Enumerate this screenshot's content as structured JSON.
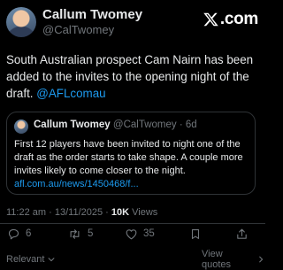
{
  "author": {
    "name": "Callum Twomey",
    "handle": "@CalTwomey"
  },
  "brand": {
    "label": ".com",
    "icon": "x-logo-icon"
  },
  "tweet": {
    "text": "South Australian prospect Cam Nairn has been added to the invites to the opening night of the draft.",
    "mention": "@AFLcomau"
  },
  "quote": {
    "name": "Callum Twomey",
    "handle": "@CalTwomey",
    "age": "6d",
    "text": "First 12 players have been invited to night one of the draft as the order starts to take shape. A couple more invites likely to come closer to the night.",
    "link": "afl.com.au/news/1450468/f..."
  },
  "meta": {
    "time": "11:22 am",
    "date": "13/11/2025",
    "views_count": "10K",
    "views_label": "Views"
  },
  "actions": {
    "replies": "6",
    "reposts": "5",
    "likes": "35"
  },
  "footer": {
    "sort_label": "Relevant",
    "view_quotes_label": "View quotes"
  },
  "colors": {
    "background": "#000000",
    "text": "#e7e9ea",
    "muted": "#71767b",
    "link": "#1d9bf0",
    "border": "#2f3336"
  }
}
